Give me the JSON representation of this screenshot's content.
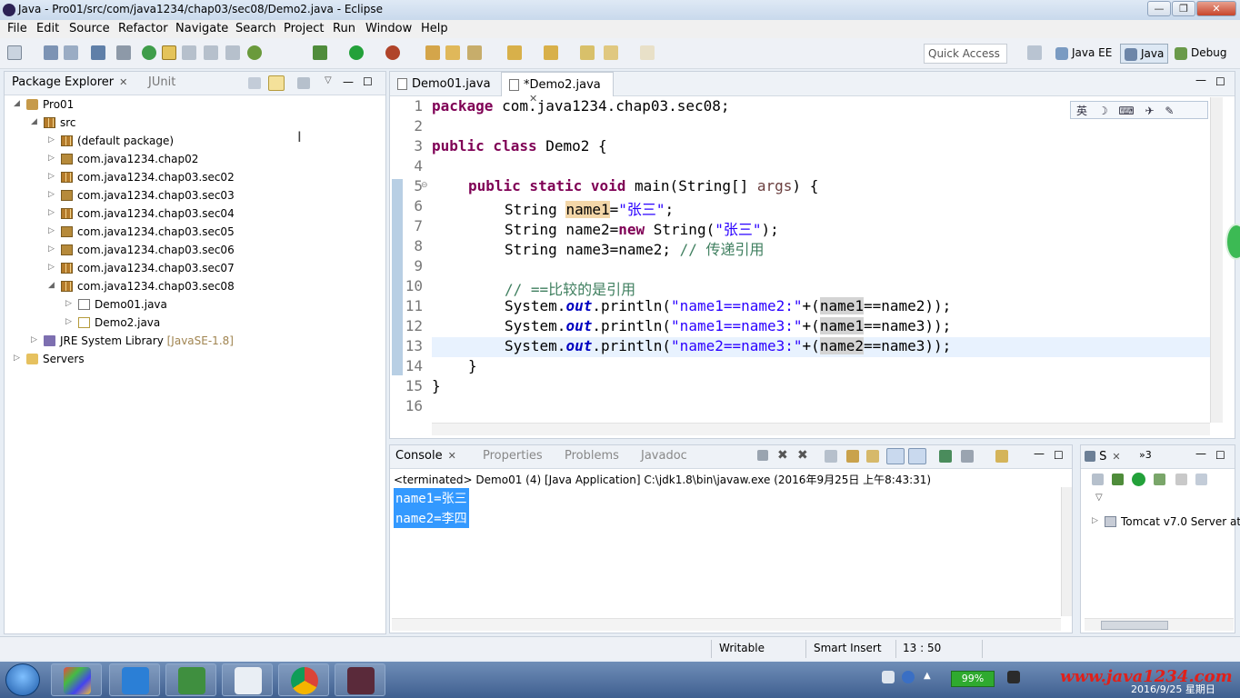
{
  "window": {
    "title": "Java - Pro01/src/com/java1234/chap03/sec08/Demo2.java - Eclipse",
    "buttons": {
      "minimize": "—",
      "maximize": "❐",
      "close": "✕"
    }
  },
  "menu": [
    "File",
    "Edit",
    "Source",
    "Refactor",
    "Navigate",
    "Search",
    "Project",
    "Run",
    "Window",
    "Help"
  ],
  "toolbar": {
    "quick_access": "Quick Access",
    "perspectives": [
      "Java EE",
      "Java",
      "Debug"
    ]
  },
  "package_explorer": {
    "tab_label": "Package Explorer",
    "junit_tab": "JUnit",
    "tree": [
      {
        "label": "Pro01",
        "depth": 0,
        "expanded": true,
        "icon": "project-icon"
      },
      {
        "label": "src",
        "depth": 1,
        "expanded": true,
        "icon": "source-folder-icon"
      },
      {
        "label": "(default package)",
        "depth": 2,
        "expanded": false,
        "icon": "package-icon"
      },
      {
        "label": "com.java1234.chap02",
        "depth": 2,
        "expanded": false,
        "icon": "package-icon"
      },
      {
        "label": "com.java1234.chap03.sec02",
        "depth": 2,
        "expanded": false,
        "icon": "package-icon"
      },
      {
        "label": "com.java1234.chap03.sec03",
        "depth": 2,
        "expanded": false,
        "icon": "package-icon"
      },
      {
        "label": "com.java1234.chap03.sec04",
        "depth": 2,
        "expanded": false,
        "icon": "package-icon"
      },
      {
        "label": "com.java1234.chap03.sec05",
        "depth": 2,
        "expanded": false,
        "icon": "package-icon"
      },
      {
        "label": "com.java1234.chap03.sec06",
        "depth": 2,
        "expanded": false,
        "icon": "package-icon"
      },
      {
        "label": "com.java1234.chap03.sec07",
        "depth": 2,
        "expanded": false,
        "icon": "package-icon"
      },
      {
        "label": "com.java1234.chap03.sec08",
        "depth": 2,
        "expanded": true,
        "icon": "package-icon"
      },
      {
        "label": "Demo01.java",
        "depth": 3,
        "expanded": false,
        "icon": "java-file-icon"
      },
      {
        "label": "Demo2.java",
        "depth": 3,
        "expanded": false,
        "icon": "java-file-icon"
      },
      {
        "label": "JRE System Library",
        "decoration": "[JavaSE-1.8]",
        "depth": 1,
        "expanded": false,
        "icon": "library-icon"
      },
      {
        "label": "Servers",
        "depth": 0,
        "expanded": false,
        "icon": "servers-folder-icon"
      }
    ]
  },
  "editor": {
    "tabs": [
      "Demo01.java",
      "*Demo2.java"
    ],
    "active_tab": 1,
    "ime_toolbar": "英 ☽ ⌨ ✈ ✎",
    "line_numbers": [
      "1",
      "2",
      "3",
      "4",
      "5",
      "6",
      "7",
      "8",
      "9",
      "10",
      "11",
      "12",
      "13",
      "14",
      "15",
      "16"
    ],
    "code": {
      "l1_kw": "package",
      "l1_rest": " com.java1234.chap03.sec08;",
      "l3_kw": "public class",
      "l3_rest": " Demo2 {",
      "l5_kw": "public static void",
      "l5_a": " main(String[] ",
      "l5_b": "args",
      "l5_c": ") {",
      "l6_a": "String ",
      "l6_b": "name1",
      "l6_c": "=",
      "l6_d": "\"张三\"",
      "l6_e": ";",
      "l7_a": "String name2=",
      "l7_b": "new",
      "l7_c": " String(",
      "l7_d": "\"张三\"",
      "l7_e": ");",
      "l8_a": "String name3=name2; ",
      "l8_b": "// 传递引用",
      "l10": "// ==比较的是引用",
      "l11_a": "System.",
      "l11_b": "out",
      "l11_c": ".println(",
      "l11_d": "\"name1==name2:\"",
      "l11_e": "+(",
      "l11_f": "name1",
      "l11_g": "==name2));",
      "l12_d": "\"name1==name3:\"",
      "l12_f": "name1",
      "l12_g": "==name3));",
      "l13_d": "\"name2==name3:\"",
      "l13_f": "name2",
      "l13_g": "==name3));",
      "l14": "}",
      "l15": "}"
    }
  },
  "console": {
    "tabs": [
      "Console",
      "Properties",
      "Problems",
      "Javadoc"
    ],
    "terminated": "<terminated> Demo01 (4) [Java Application] C:\\jdk1.8\\bin\\javaw.exe (2016年9月25日 上午8:43:31)",
    "output": [
      "name1=张三",
      "name2=李四"
    ]
  },
  "servers": {
    "tab_label": "S",
    "overflow": "»3",
    "item": "Tomcat v7.0 Server at"
  },
  "statusbar": {
    "writable": "Writable",
    "insert_mode": "Smart Insert",
    "position": "13 : 50"
  },
  "taskbar": {
    "battery": "99%",
    "watermark": "www.java1234.com",
    "clock": "2016/9/25 星期日"
  }
}
